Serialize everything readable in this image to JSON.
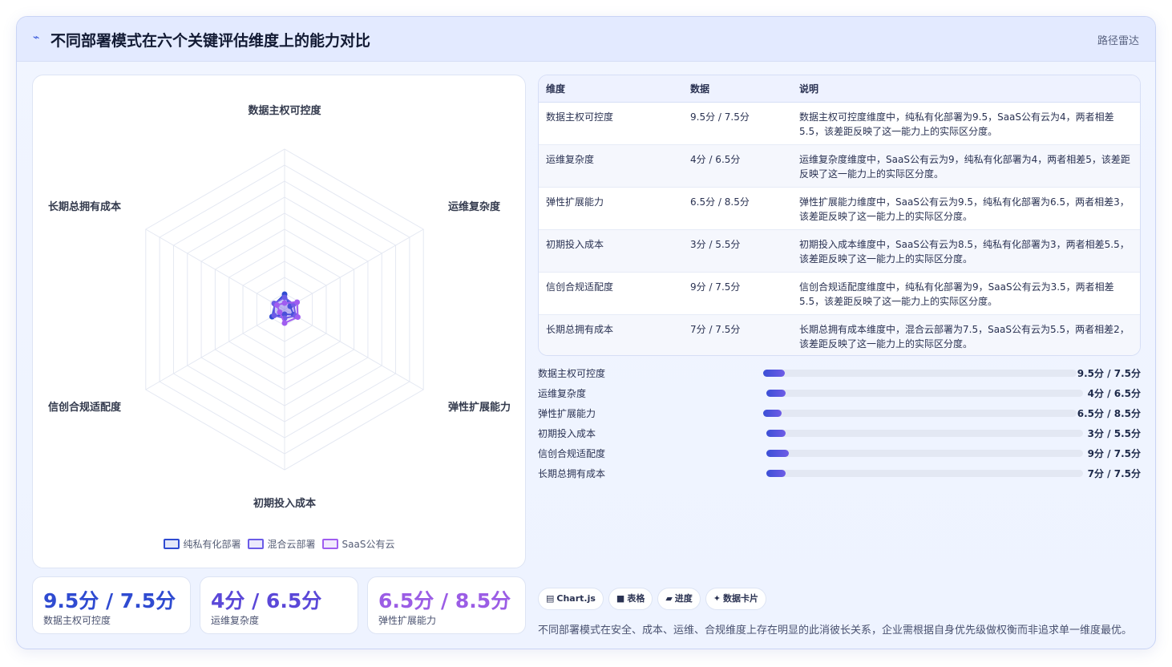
{
  "header": {
    "logo_icon": "trend-line-icon",
    "title": "不同部署模式在六个关键评估维度上的能力对比",
    "tag": "路径雷达"
  },
  "chart_data": {
    "type": "radar",
    "axes": [
      "数据主权可控度",
      "运维复杂度",
      "弹性扩展能力",
      "初期投入成本",
      "信创合规适配度",
      "长期总拥有成本"
    ],
    "rlim": [
      0,
      100
    ],
    "grid": true,
    "legend_position": "bottom",
    "series": [
      {
        "name": "纯私有化部署",
        "color": "#2f4bd1",
        "values": [
          9.5,
          4,
          6.5,
          3,
          9,
          7
        ]
      },
      {
        "name": "混合云部署",
        "color": "#6b5ce7",
        "values": [
          7.5,
          6.5,
          8,
          5.5,
          7.5,
          7.5
        ]
      },
      {
        "name": "SaaS公有云",
        "color": "#a05df0",
        "values": [
          4,
          9,
          9.5,
          8.5,
          3.5,
          5.5
        ]
      }
    ]
  },
  "kpis": [
    {
      "value": "9.5分 / 7.5分",
      "label": "数据主权可控度",
      "color": "#2f4bd1"
    },
    {
      "value": "4分 / 6.5分",
      "label": "运维复杂度",
      "color": "#5b48d8"
    },
    {
      "value": "6.5分 / 8.5分",
      "label": "弹性扩展能力",
      "color": "#9b5de5"
    }
  ],
  "table": {
    "headers": [
      "维度",
      "数据",
      "说明"
    ],
    "rows": [
      {
        "dim": "数据主权可控度",
        "data": "9.5分 / 7.5分",
        "desc": "数据主权可控度维度中，纯私有化部署为9.5，SaaS公有云为4，两者相差5.5，该差距反映了这一能力上的实际区分度。"
      },
      {
        "dim": "运维复杂度",
        "data": "4分 / 6.5分",
        "desc": "运维复杂度维度中，SaaS公有云为9，纯私有化部署为4，两者相差5，该差距反映了这一能力上的实际区分度。"
      },
      {
        "dim": "弹性扩展能力",
        "data": "6.5分 / 8.5分",
        "desc": "弹性扩展能力维度中，SaaS公有云为9.5，纯私有化部署为6.5，两者相差3，该差距反映了这一能力上的实际区分度。"
      },
      {
        "dim": "初期投入成本",
        "data": "3分 / 5.5分",
        "desc": "初期投入成本维度中，SaaS公有云为8.5，纯私有化部署为3，两者相差5.5，该差距反映了这一能力上的实际区分度。"
      },
      {
        "dim": "信创合规适配度",
        "data": "9分 / 7.5分",
        "desc": "信创合规适配度维度中，纯私有化部署为9，SaaS公有云为3.5，两者相差5.5，该差距反映了这一能力上的实际区分度。"
      },
      {
        "dim": "长期总拥有成本",
        "data": "7分 / 7.5分",
        "desc": "长期总拥有成本维度中，混合云部署为7.5，SaaS公有云为5.5，两者相差2，该差距反映了这一能力上的实际区分度。"
      }
    ]
  },
  "bars": [
    {
      "label": "数据主权可控度",
      "value": "9.5分 / 7.5分",
      "fill_fraction": 0.07
    },
    {
      "label": "运维复杂度",
      "value": "4分 / 6.5分",
      "fill_fraction": 0.06
    },
    {
      "label": "弹性扩展能力",
      "value": "6.5分 / 8.5分",
      "fill_fraction": 0.06
    },
    {
      "label": "初期投入成本",
      "value": "3分 / 5.5分",
      "fill_fraction": 0.06
    },
    {
      "label": "信创合规适配度",
      "value": "9分 / 7.5分",
      "fill_fraction": 0.07
    },
    {
      "label": "长期总拥有成本",
      "value": "7分 / 7.5分",
      "fill_fraction": 0.06
    }
  ],
  "chips": [
    {
      "icon": "chart-icon",
      "glyph": "▤",
      "label": "Chart.js"
    },
    {
      "icon": "table-icon",
      "glyph": "■",
      "label": "表格"
    },
    {
      "icon": "progress-icon",
      "glyph": "▰",
      "label": "进度"
    },
    {
      "icon": "card-icon",
      "glyph": "✦",
      "label": "数据卡片"
    }
  ],
  "summary": "不同部署模式在安全、成本、运维、合规维度上存在明显的此消彼长关系，企业需根据自身优先级做权衡而非追求单一维度最优。"
}
